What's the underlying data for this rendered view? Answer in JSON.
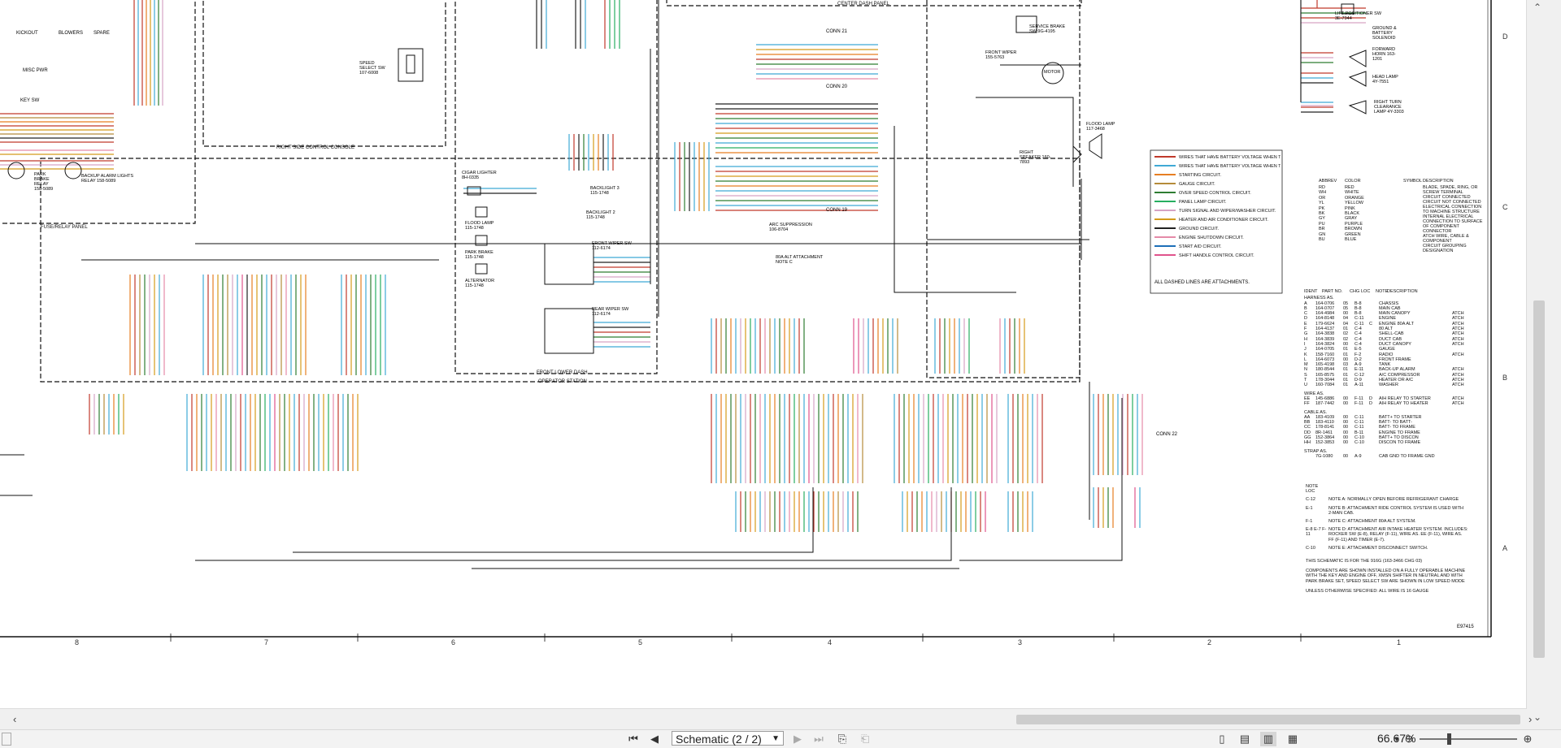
{
  "viewer": {
    "title": "Schematic (2 / 2)",
    "zoom": "66.67%",
    "page_select_label": "Schematic (2 / 2)"
  },
  "colors": {
    "battery_off": "#c0392b",
    "battery_on": "#3fa9d5",
    "starting": "#e67e22",
    "gauge": "#b58b3a",
    "overspeed": "#2e7d32",
    "panel_lamp": "#27ae60",
    "turn_wiper": "#d6a3c4",
    "heater_ac": "#d49b1a",
    "ground": "#222222",
    "shutdown": "#e58aa8",
    "start_aid": "#1d6fb8",
    "shift_handle": "#e0538c"
  },
  "schematic": {
    "panels": {
      "center_dash": "CENTER DASH PANEL",
      "right_side_console": "RIGHT SIDE CONTROL CONSOLE",
      "fuse_relay": "FUSE/RELAY PANEL",
      "front_lower_dash": "FRONT LOWER DASH",
      "operator_station": "OPERATOR STATION"
    },
    "components": {
      "kickout": "KICKOUT",
      "blowers": "BLOWERS",
      "spare": "SPARE",
      "misc_pwr": "MISC PWR",
      "key_sw": "KEY SW",
      "park_brake_relay": "PARK BRAKE RELAY 158-5089",
      "backup_alarm_relay": "BACKUP ALARM LIGHTS RELAY 158-5089",
      "speed_select": "SPEED SELECT SW 107-6008",
      "cigar_lighter": "CIGAR LIGHTER 8H-0335",
      "flood_lamp": "FLOOD LAMP 115-1748",
      "park_brake": "PARK BRAKE 115-1748",
      "alternator": "ALTERNATOR 115-1748",
      "backlight3": "BACKLIGHT 3 115-1748",
      "backlight2": "BACKLIGHT 2 115-1748",
      "front_wiper_sw": "FRONT WIPER SW 112-6174",
      "rear_wiper_sw": "REAR WIPER SW 112-6174",
      "conn21": "CONN 21",
      "conn20": "CONN 20",
      "conn19": "CONN 19",
      "conn22": "CONN 22",
      "arc_suppression": "ARC SUPPRESSION 106-8704",
      "alt_attachment": "80A ALT ATTACHMENT NOTE C",
      "service_brake": "SERVICE BRAKE SW 9G-4195",
      "front_wiper": "FRONT WIPER 155-5763",
      "motor": "MOTOR",
      "flood_lamp_right": "FLOOD LAMP 117-3468",
      "right_speaker": "RIGHT SPEAKER 160-7893",
      "lift_positioner": "LIFT POSITIONER SW 3E-7944",
      "ground_battery_solenoid": "GROUND & BATTERY SOLENOID",
      "forward_horn": "FORWARD HORN 163-1201",
      "head_lamp": "HEAD LAMP 4Y-7551",
      "right_turn_lamp": "RIGHT TURN CLEARANCE LAMP 4Y-3303"
    },
    "legend": [
      {
        "label": "WIRES THAT HAVE BATTERY VOLTAGE WHEN THE KEY SWITCH IS OFF.",
        "color": "#c0392b"
      },
      {
        "label": "WIRES THAT HAVE BATTERY VOLTAGE WHEN THE KEY SWITCH IS ON.",
        "color": "#3fa9d5"
      },
      {
        "label": "STARTING CIRCUIT.",
        "color": "#e67e22"
      },
      {
        "label": "GAUGE CIRCUIT.",
        "color": "#b58b3a"
      },
      {
        "label": "OVER SPEED CONTROL CIRCUIT.",
        "color": "#2e7d32"
      },
      {
        "label": "PANEL LAMP CIRCUIT.",
        "color": "#27ae60"
      },
      {
        "label": "TURN SIGNAL AND WIPER/WASHER CIRCUIT.",
        "color": "#d6a3c4"
      },
      {
        "label": "HEATER AND AIR CONDITIONER CIRCUIT.",
        "color": "#d49b1a"
      },
      {
        "label": "GROUND CIRCUIT.",
        "color": "#222222"
      },
      {
        "label": "ENGINE SHUTDOWN CIRCUIT.",
        "color": "#e58aa8"
      },
      {
        "label": "START AID CIRCUIT.",
        "color": "#1d6fb8"
      },
      {
        "label": "SHIFT HANDLE CONTROL CIRCUIT.",
        "color": "#e0538c"
      }
    ],
    "legend_note": "ALL DASHED LINES ARE ATTACHMENTS.",
    "abbrev_header": [
      "ABBREV",
      "COLOR"
    ],
    "abbrev": [
      [
        "RD",
        "RED"
      ],
      [
        "WH",
        "WHITE"
      ],
      [
        "OR",
        "ORANGE"
      ],
      [
        "YL",
        "YELLOW"
      ],
      [
        "PK",
        "PINK"
      ],
      [
        "BK",
        "BLACK"
      ],
      [
        "GY",
        "GRAY"
      ],
      [
        "PU",
        "PURPLE"
      ],
      [
        "BR",
        "BROWN"
      ],
      [
        "GN",
        "GREEN"
      ],
      [
        "BU",
        "BLUE"
      ]
    ],
    "symbol_header": [
      "SYMBOL",
      "DESCRIPTION"
    ],
    "symbols": [
      "BLADE, SPADE, RING, OR SCREW TERMINAL",
      "CIRCUIT CONNECTED",
      "CIRCUIT NOT CONNECTED",
      "ELECTRICAL CONNECTION TO MACHINE STRUCTURE",
      "INTERNAL ELECTRICAL CONNECTION TO SURFACE OF COMPONENT",
      "CONNECTOR",
      "ATCH WIRE, CABLE & COMPONENT",
      "CIRCUIT GROUPING DESIGNATION"
    ],
    "harness_header": [
      "IDENT",
      "PART NO.",
      "CHG",
      "LOC",
      "NOTE",
      "DESCRIPTION"
    ],
    "harness_title": "HARNESS AS.",
    "harness": [
      [
        "A",
        "164-0706",
        "05",
        "B-8",
        "",
        "CHASSIS",
        ""
      ],
      [
        "B",
        "164-0707",
        "05",
        "B-8",
        "",
        "MAIN CAB",
        ""
      ],
      [
        "C",
        "164-4984",
        "00",
        "B-8",
        "",
        "MAIN CANOPY",
        "ATCH"
      ],
      [
        "D",
        "164-8148",
        "04",
        "C-11",
        "",
        "ENGINE",
        "ATCH"
      ],
      [
        "E",
        "179-6624",
        "04",
        "C-11",
        "C",
        "ENGINE 80A ALT",
        "ATCH"
      ],
      [
        "F",
        "164-4137",
        "01",
        "C-4",
        "",
        "80 ALT",
        "ATCH"
      ],
      [
        "G",
        "164-3838",
        "02",
        "C-4",
        "",
        "SHELL-CAB",
        "ATCH"
      ],
      [
        "H",
        "164-3839",
        "02",
        "C-4",
        "",
        "DUCT CAB",
        "ATCH"
      ],
      [
        "I",
        "164-3824",
        "00",
        "C-4",
        "",
        "DUCT CANOPY",
        "ATCH"
      ],
      [
        "J",
        "164-0705",
        "01",
        "E-5",
        "",
        "GAUGE",
        ""
      ],
      [
        "K",
        "158-7160",
        "01",
        "F-2",
        "",
        "RADIO",
        "ATCH"
      ],
      [
        "L",
        "164-6073",
        "00",
        "D-2",
        "",
        "FRONT FRAME",
        ""
      ],
      [
        "M",
        "165-4198",
        "03",
        "A-9",
        "",
        "TANK",
        ""
      ],
      [
        "N",
        "180-8544",
        "01",
        "E-11",
        "",
        "BACK-UP ALARM",
        "ATCH"
      ],
      [
        "S",
        "165-8575",
        "01",
        "C-12",
        "",
        "A/C COMPRESSOR",
        "ATCH"
      ],
      [
        "T",
        "178-3044",
        "01",
        "D-9",
        "",
        "HEATER OR A/C",
        "ATCH"
      ],
      [
        "U",
        "160-7084",
        "01",
        "A-11",
        "",
        "WASHER",
        "ATCH"
      ]
    ],
    "wire_title": "WIRE AS.",
    "wires": [
      [
        "EE",
        "145-6886",
        "00",
        "F-11",
        "D",
        "AIH RELAY TO STARTER",
        "ATCH"
      ],
      [
        "FF",
        "187-7442",
        "00",
        "F-11",
        "D",
        "AIH RELAY TO HEATER",
        "ATCH"
      ]
    ],
    "cable_title": "CABLE AS.",
    "cables": [
      [
        "AA",
        "183-4109",
        "00",
        "C-11",
        "",
        "BATT+ TO STARTER"
      ],
      [
        "BB",
        "183-4110",
        "00",
        "C-11",
        "",
        "BATT- TO BATT-"
      ],
      [
        "CC",
        "178-8141",
        "00",
        "C-11",
        "",
        "BATT- TO FRAME"
      ],
      [
        "DD",
        "8R-1461",
        "00",
        "B-11",
        "",
        "ENGINE TO FRAME"
      ],
      [
        "GG",
        "152-3864",
        "00",
        "C-10",
        "",
        "BATT+ TO DISCON"
      ],
      [
        "HH",
        "152-3853",
        "00",
        "C-10",
        "",
        "DISCON TO FRAME"
      ]
    ],
    "strap_title": "STRAP AS.",
    "straps": [
      [
        "",
        "7G-1080",
        "00",
        "A-9",
        "",
        "CAB GND TO FRAME GND"
      ]
    ],
    "notes_title": "NOTE LOC",
    "notes": [
      [
        "C-12",
        "NOTE A: NORMALLY OPEN BEFORE REFRIGERANT CHARGE"
      ],
      [
        "E-1",
        "NOTE B: ATTACHMENT RIDE CONTROL SYSTEM IS USED WITH 2-MAN CAB."
      ],
      [
        "F-1",
        "NOTE C: ATTACHMENT 80A ALT SYSTEM."
      ],
      [
        "E-8 E-7 F-11",
        "NOTE D: ATTACHMENT AIR INTAKE HEATER SYSTEM. INCLUDES: ROCKER SW (E-8), RELAY (F-11), WIRE AS. EE (F-11), WIRE AS. FF (F-11) AND TIMER (E-7)."
      ],
      [
        "C-10",
        "NOTE E: ATTACHMENT DISCONNECT SWITCH."
      ]
    ],
    "footer_notes": [
      "THIS SCHEMATIC IS FOR THE 916G (163-3466 CHG 03)",
      "COMPONENTS ARE SHOWN INSTALLED ON A FULLY OPERABLE MACHINE WITH THE KEY AND ENGINE OFF, XMSN SHIFTER IN NEUTRAL AND WITH PARK BRAKE SET, SPEED SELECT SW ARE SHOWN IN LOW SPEED MODE",
      "UNLESS OTHERWISE SPECIFIED: ALL WIRE IS 16 GAUGE"
    ],
    "drawing_number": "E97415",
    "column_numbers": [
      "8",
      "7",
      "6",
      "5",
      "4",
      "3",
      "2",
      "1"
    ],
    "row_letters": [
      "D",
      "C",
      "B",
      "A"
    ]
  }
}
